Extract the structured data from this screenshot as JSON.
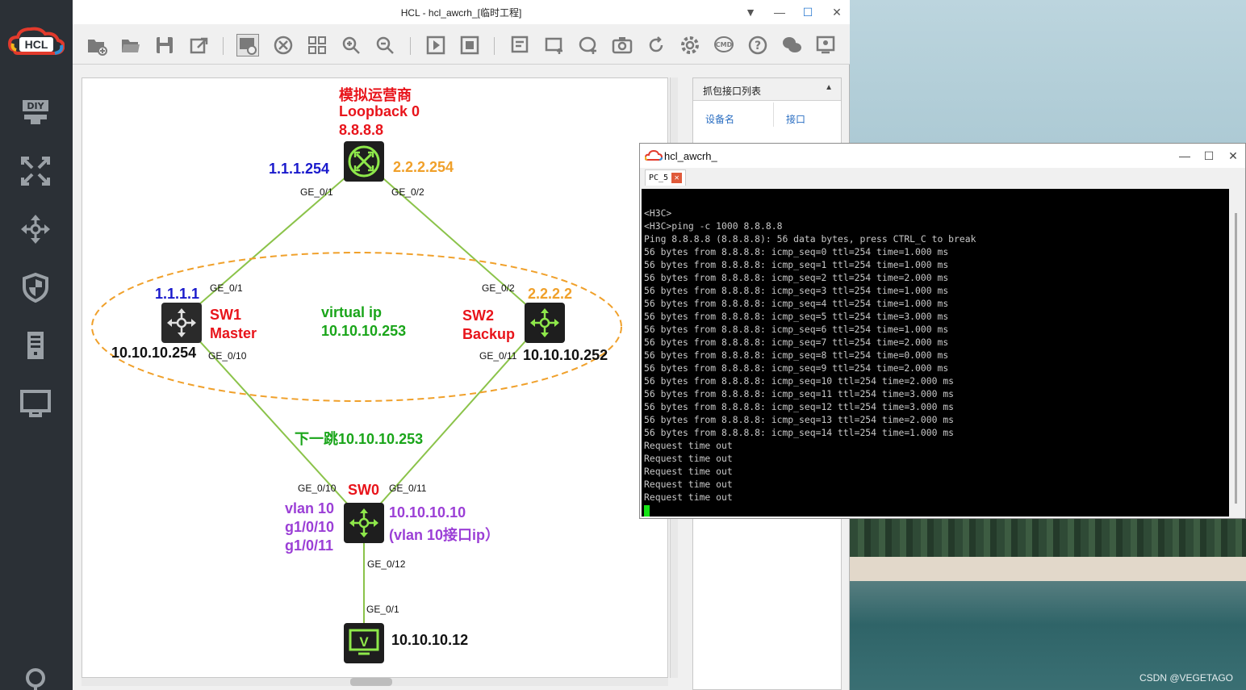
{
  "main_window": {
    "title": "HCL - hcl_awcrh_[临时工程]"
  },
  "topology": {
    "operator": {
      "name": "模拟运营商",
      "loopback": "Loopback 0",
      "ip": "8.8.8.8",
      "left_ip": "1.1.1.254",
      "right_ip": "2.2.2.254",
      "port_left": "GE_0/1",
      "port_right": "GE_0/2"
    },
    "sw1": {
      "name": "SW1",
      "role": "Master",
      "top_ip": "1.1.1.1",
      "bottom_ip": "10.10.10.254",
      "port_up": "GE_0/1",
      "port_down": "GE_0/10"
    },
    "sw2": {
      "name": "SW2",
      "role": "Backup",
      "top_ip": "2.2.2.2",
      "bottom_ip": "10.10.10.252",
      "port_up": "GE_0/2",
      "port_down": "GE_0/11"
    },
    "virtual_ip": {
      "label": "virtual ip",
      "ip": "10.10.10.253"
    },
    "next_hop": "下一跳10.10.10.253",
    "sw0": {
      "name": "SW0",
      "vlan": "vlan 10",
      "if1": "g1/0/10",
      "if2": "g1/0/11",
      "ip": "10.10.10.10",
      "ip_note": "(vlan 10接口ip）",
      "port_left": "GE_0/10",
      "port_right": "GE_0/11",
      "port_down": "GE_0/12"
    },
    "pc": {
      "ip": "10.10.10.12",
      "port": "GE_0/1"
    }
  },
  "capture_panel": {
    "title": "抓包接口列表",
    "col_device": "设备名",
    "col_interface": "接口"
  },
  "terminal": {
    "title": "hcl_awcrh_",
    "tab": "PC_5",
    "lines": [
      "<H3C>",
      "<H3C>ping -c 1000 8.8.8.8",
      "Ping 8.8.8.8 (8.8.8.8): 56 data bytes, press CTRL_C to break",
      "56 bytes from 8.8.8.8: icmp_seq=0 ttl=254 time=1.000 ms",
      "56 bytes from 8.8.8.8: icmp_seq=1 ttl=254 time=1.000 ms",
      "56 bytes from 8.8.8.8: icmp_seq=2 ttl=254 time=2.000 ms",
      "56 bytes from 8.8.8.8: icmp_seq=3 ttl=254 time=1.000 ms",
      "56 bytes from 8.8.8.8: icmp_seq=4 ttl=254 time=1.000 ms",
      "56 bytes from 8.8.8.8: icmp_seq=5 ttl=254 time=3.000 ms",
      "56 bytes from 8.8.8.8: icmp_seq=6 ttl=254 time=1.000 ms",
      "56 bytes from 8.8.8.8: icmp_seq=7 ttl=254 time=2.000 ms",
      "56 bytes from 8.8.8.8: icmp_seq=8 ttl=254 time=0.000 ms",
      "56 bytes from 8.8.8.8: icmp_seq=9 ttl=254 time=2.000 ms",
      "56 bytes from 8.8.8.8: icmp_seq=10 ttl=254 time=2.000 ms",
      "56 bytes from 8.8.8.8: icmp_seq=11 ttl=254 time=3.000 ms",
      "56 bytes from 8.8.8.8: icmp_seq=12 ttl=254 time=3.000 ms",
      "56 bytes from 8.8.8.8: icmp_seq=13 ttl=254 time=2.000 ms",
      "56 bytes from 8.8.8.8: icmp_seq=14 ttl=254 time=1.000 ms",
      "Request time out",
      "Request time out",
      "Request time out",
      "Request time out",
      "Request time out"
    ]
  },
  "watermark": "CSDN @VEGETAGO",
  "colors": {
    "red": "#e8141b",
    "blue": "#1a1acc",
    "orange": "#f0a02a",
    "green": "#1aa51a",
    "purple": "#9b3fd6",
    "link": "#8bc34a",
    "sidebar": "#2b3036"
  }
}
